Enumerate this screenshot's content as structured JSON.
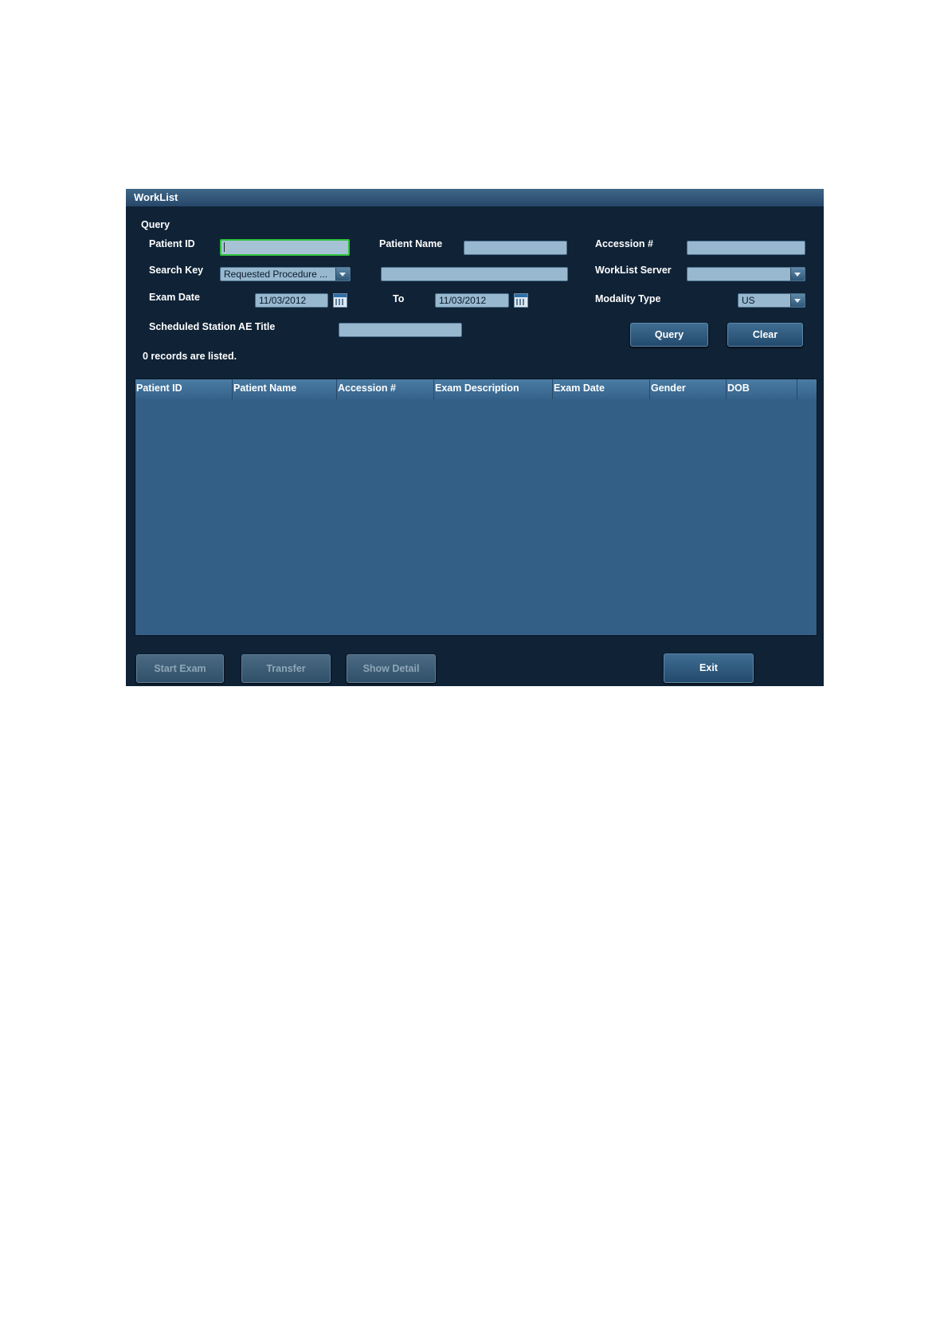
{
  "window": {
    "title": "WorkList"
  },
  "query": {
    "section_label": "Query",
    "patient_id_label": "Patient ID",
    "patient_id_value": "",
    "patient_name_label": "Patient Name",
    "patient_name_value": "",
    "accession_label": "Accession #",
    "accession_value": "",
    "search_key_label": "Search Key",
    "search_key_value": "Requested Procedure ...",
    "search_key_text": "",
    "worklist_server_label": "WorkList Server",
    "worklist_server_value": "",
    "exam_date_label": "Exam Date",
    "exam_date_from": "11/03/2012",
    "to_label": "To",
    "exam_date_to": "11/03/2012",
    "modality_type_label": "Modality Type",
    "modality_type_value": "US",
    "ae_title_label": "Scheduled Station AE Title",
    "ae_title_value": "",
    "query_button": "Query",
    "clear_button": "Clear",
    "records_status": "0 records are listed."
  },
  "table": {
    "columns": [
      "Patient ID",
      "Patient Name",
      "Accession #",
      "Exam Description",
      "Exam Date",
      "Gender",
      "DOB"
    ],
    "rows": []
  },
  "footer": {
    "start_exam": "Start Exam",
    "transfer": "Transfer",
    "show_detail": "Show Detail",
    "exit": "Exit"
  },
  "icons": {
    "calendar": "calendar-icon",
    "dropdown": "chevron-down-icon"
  }
}
